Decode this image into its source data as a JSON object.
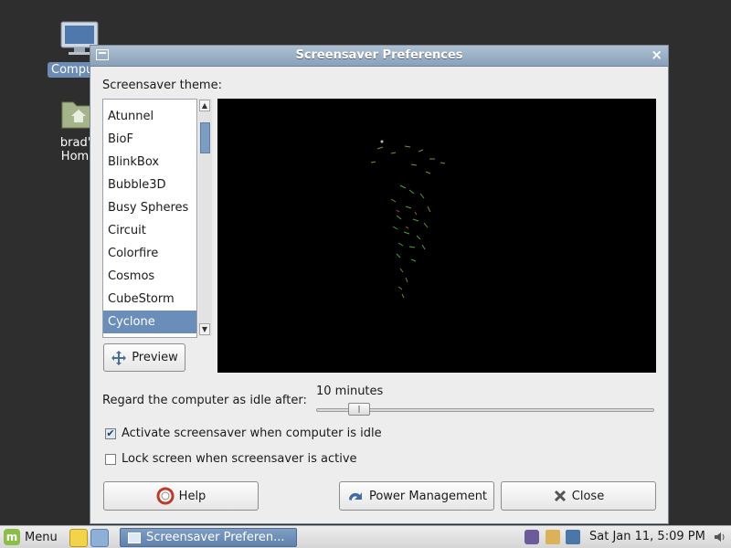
{
  "desktop": {
    "icons": [
      {
        "label": "Computer"
      },
      {
        "label": "brad's Home"
      }
    ]
  },
  "window": {
    "title": "Screensaver Preferences",
    "theme_label": "Screensaver theme:",
    "themes": [
      "Atunnel",
      "BioF",
      "BlinkBox",
      "Bubble3D",
      "Busy Spheres",
      "Circuit",
      "Colorfire",
      "Cosmos",
      "CubeStorm",
      "Cyclone"
    ],
    "selected_theme": "Cyclone",
    "preview_label": "Preview",
    "idle_label": "Regard the computer as idle after:",
    "idle_value": "10 minutes",
    "idle_slider_fraction": 0.1,
    "activate_label": "Activate screensaver when computer is idle",
    "activate_checked": true,
    "lock_label": "Lock screen when screensaver is active",
    "lock_checked": false,
    "help_label": "Help",
    "power_label": "Power Management",
    "close_label": "Close"
  },
  "taskbar": {
    "menu_label": "Menu",
    "task_label": "Screensaver Preferen...",
    "clock": "Sat Jan 11,  5:09 PM"
  },
  "colors": {
    "selection": "#6a8db9",
    "titlebar": "#9bb0c8",
    "preview_bg": "#000000"
  }
}
